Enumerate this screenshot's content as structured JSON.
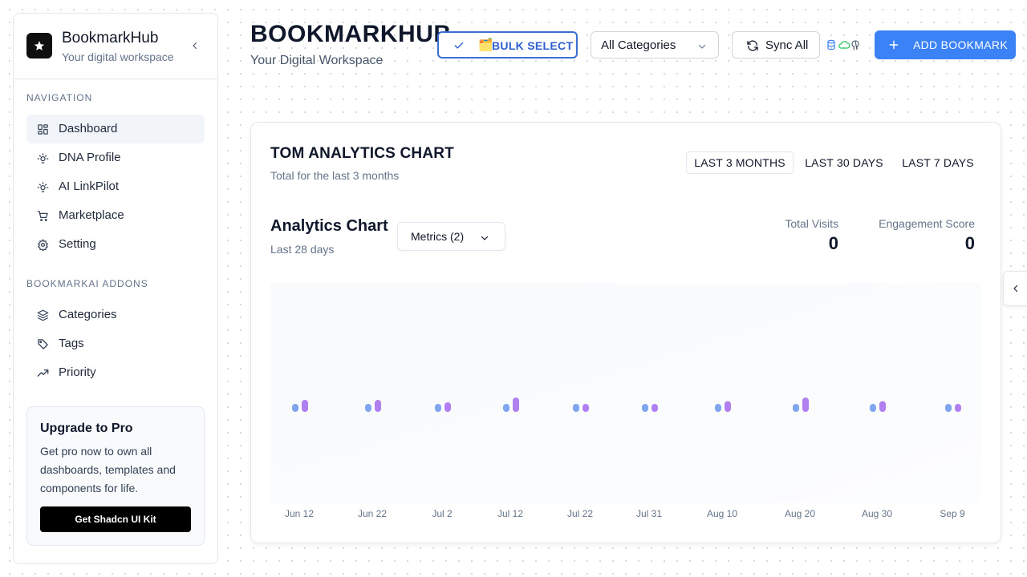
{
  "sidebar": {
    "brand_name": "BookmarkHub",
    "brand_sub": "Your digital workspace",
    "nav_label": "NAVIGATION",
    "nav_items": [
      {
        "label": "Dashboard",
        "icon": "dashboard-icon",
        "active": true
      },
      {
        "label": "DNA Profile",
        "icon": "lightbulb-icon"
      },
      {
        "label": "AI LinkPilot",
        "icon": "lightbulb-icon"
      },
      {
        "label": "Marketplace",
        "icon": "cart-icon"
      },
      {
        "label": "Setting",
        "icon": "gear-icon"
      }
    ],
    "addons_label": "BOOKMARKAI ADDONS",
    "addon_items": [
      {
        "label": "Categories",
        "icon": "layers-icon"
      },
      {
        "label": "Tags",
        "icon": "tag-icon"
      },
      {
        "label": "Priority",
        "icon": "trending-up-icon"
      }
    ],
    "upgrade": {
      "title": "Upgrade to Pro",
      "text": "Get pro now to own all dashboards, templates and components for life.",
      "button": "Get Shadcn UI Kit"
    }
  },
  "header": {
    "title": "BOOKMARKHUB",
    "subtitle": "Your Digital Workspace",
    "bulk_select": "BULK SELECT",
    "bulk_emoji": "🗂️",
    "category_select": "All Categories",
    "sync": "Sync All",
    "add": "ADD BOOKMARK"
  },
  "card": {
    "title": "TOM ANALYTICS CHART",
    "subtitle": "Total for the last 3 months",
    "ranges": [
      "LAST 3 MONTHS",
      "LAST 30 DAYS",
      "LAST 7 DAYS"
    ],
    "active_range": 0,
    "chart_title": "Analytics Chart",
    "chart_sub": "Last 28 days",
    "metrics_button": "Metrics (2)",
    "stats": [
      {
        "label": "Total Visits",
        "value": "0"
      },
      {
        "label": "Engagement Score",
        "value": "0"
      }
    ]
  },
  "colors": {
    "accent": "#3b82f6",
    "series_visits": "#7fa6ee",
    "series_engagement": "#b07ff0"
  },
  "chart_data": {
    "type": "bar",
    "categories": [
      "Jun 12",
      "Jun 22",
      "Jul 2",
      "Jul 12",
      "Jul 22",
      "Jul 31",
      "Aug 10",
      "Aug 20",
      "Aug 30",
      "Sep 9"
    ],
    "series": [
      {
        "values": [
          0.6,
          0.6,
          0.6,
          0.6,
          0.6,
          0.6,
          0.6,
          0.6,
          0.6,
          0.6
        ]
      },
      {
        "values": [
          1.0,
          1.0,
          0.8,
          1.2,
          0.6,
          0.6,
          0.9,
          1.2,
          0.9,
          0.6
        ]
      }
    ],
    "grid": false
  }
}
